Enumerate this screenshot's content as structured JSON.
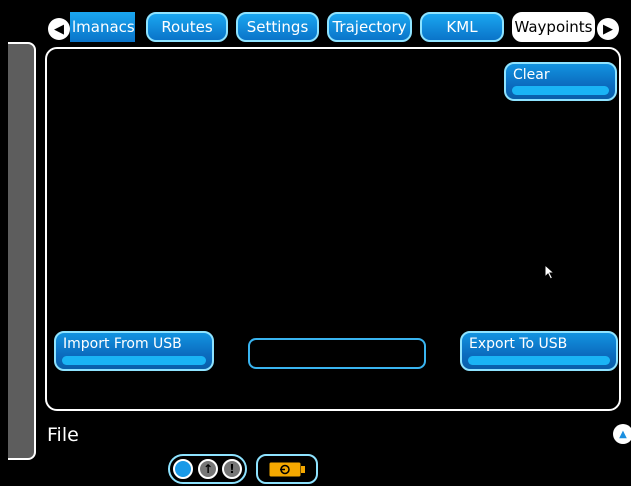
{
  "tabs": {
    "items": [
      {
        "label": "lmanacs"
      },
      {
        "label": "Routes"
      },
      {
        "label": "Settings"
      },
      {
        "label": "Trajectory"
      },
      {
        "label": "KML"
      },
      {
        "label": "Waypoints",
        "active": true
      }
    ],
    "prev_icon": "left-arrow-icon",
    "next_icon": "right-arrow-icon"
  },
  "main": {
    "clear_label": "Clear",
    "import_label": "Import From USB",
    "export_label": "Export To USB",
    "filename_value": ""
  },
  "status": {
    "title": "File"
  },
  "colors": {
    "accent": "#0a74c9",
    "accent_light": "#8ee3ff",
    "battery": "#f5a800"
  }
}
